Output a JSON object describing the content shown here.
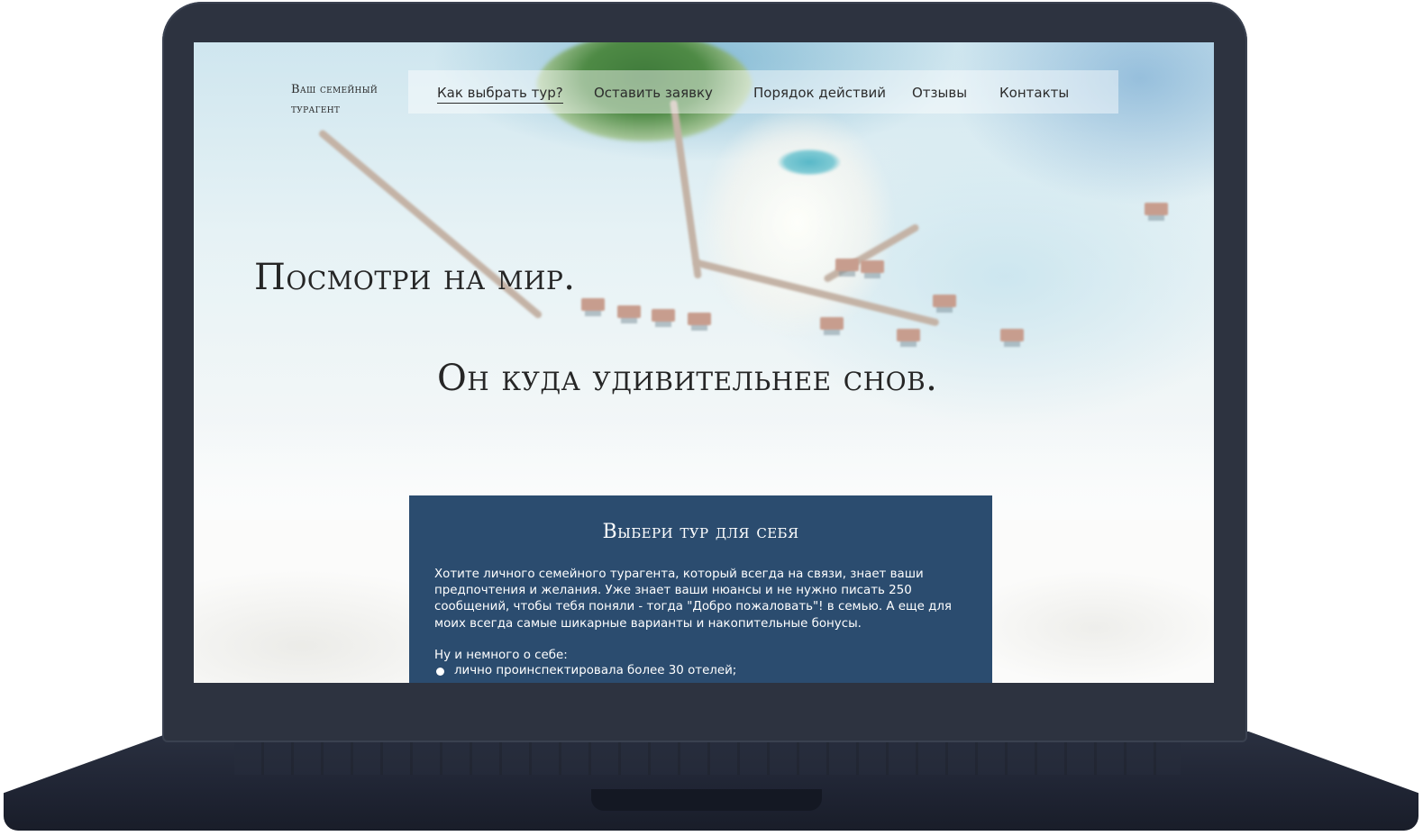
{
  "site": {
    "logo": "Ваш семейный турагент"
  },
  "nav": {
    "items": [
      {
        "label": "Как выбрать тур?",
        "active": true
      },
      {
        "label": "Оставить заявку"
      },
      {
        "label": "Порядок действий"
      },
      {
        "label": "Отзывы"
      },
      {
        "label": "Контакты"
      }
    ]
  },
  "hero": {
    "line1": "Посмотри на мир.",
    "line2": "Он куда удивительнее снов."
  },
  "card": {
    "title": "Выбери тур для себя",
    "text": "Хотите личного семейного турагента, который всегда на связи, знает ваши предпочтения и желания. Уже знает ваши нюансы и не нужно писать 250 сообщений, чтобы тебя поняли - тогда \"Добро пожаловать\"! в семью. А еще для моих всегда самые шикарные варианты и накопительные бонусы.",
    "subtitle": "Ну и немного о себе:",
    "list": [
      "лично проинспектировала более 30 отелей;"
    ]
  },
  "colors": {
    "frame": "#2d3340",
    "card_bg": "#2b4c6f",
    "text_dark": "#262626"
  }
}
